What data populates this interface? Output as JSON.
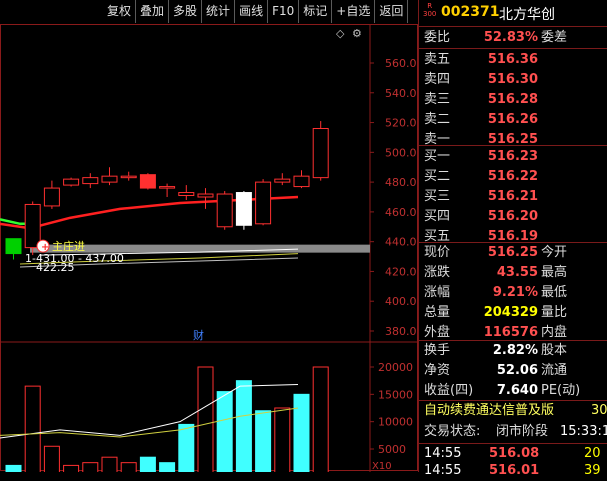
{
  "toolbar": [
    "复权",
    "叠加",
    "多股",
    "统计",
    "画线",
    "F10",
    "标记",
    "+自选",
    "返回"
  ],
  "stock": {
    "badge_top": "R",
    "badge_bottom": "300",
    "code": "002371",
    "name": "北方华创"
  },
  "webi": {
    "label": "委比",
    "value": "52.83%",
    "label2": "委差"
  },
  "asks": [
    {
      "label": "卖五",
      "price": "516.36"
    },
    {
      "label": "卖四",
      "price": "516.30"
    },
    {
      "label": "卖三",
      "price": "516.28"
    },
    {
      "label": "卖二",
      "price": "516.26"
    },
    {
      "label": "卖一",
      "price": "516.25"
    }
  ],
  "bids": [
    {
      "label": "买一",
      "price": "516.23"
    },
    {
      "label": "买二",
      "price": "516.22"
    },
    {
      "label": "买三",
      "price": "516.21"
    },
    {
      "label": "买四",
      "price": "516.20"
    },
    {
      "label": "买五",
      "price": "516.19"
    }
  ],
  "stats": [
    {
      "label": "现价",
      "value": "516.25",
      "color": "red",
      "label2": "今开"
    },
    {
      "label": "涨跌",
      "value": "43.55",
      "color": "red",
      "label2": "最高"
    },
    {
      "label": "涨幅",
      "value": "9.21%",
      "color": "red",
      "label2": "最低"
    },
    {
      "label": "总量",
      "value": "204329",
      "color": "yel",
      "label2": "量比"
    },
    {
      "label": "外盘",
      "value": "116576",
      "color": "red",
      "label2": "内盘"
    }
  ],
  "stats2": [
    {
      "label": "换手",
      "value": "2.82%",
      "color": "wht",
      "label2": "股本"
    },
    {
      "label": "净资",
      "value": "52.06",
      "color": "wht",
      "label2": "流通"
    },
    {
      "label": "收益(四)",
      "value": "7.640",
      "color": "wht",
      "label2": "PE(动)"
    }
  ],
  "info": {
    "industry": "自动续费通达信普及版",
    "industry_num": "30",
    "status_label": "交易状态:",
    "status": "闭市阶段",
    "time": "15:33:1"
  },
  "ticks": [
    {
      "time": "14:55",
      "price": "516.08",
      "vol": "20"
    },
    {
      "time": "14:55",
      "price": "516.01",
      "vol": "39"
    }
  ],
  "chart_annotations": {
    "diamond": "◇",
    "gear": "⚙",
    "main_force": "主庄进",
    "ma_text": "437.00",
    "ma_text_prefix": "1-431.00 -",
    "low_label": "422.25",
    "cai": "财",
    "x10": "X10"
  },
  "chart_data": {
    "type": "candlestick",
    "price_axis": {
      "labels": [
        "560.0",
        "540.0",
        "520.0",
        "500.0",
        "480.0",
        "460.0",
        "440.0",
        "420.0",
        "400.0",
        "380.0"
      ],
      "values": [
        560,
        540,
        520,
        500,
        480,
        460,
        440,
        420,
        400,
        380
      ]
    },
    "volume_axis": {
      "labels": [
        "20000",
        "15000",
        "10000",
        "5000"
      ],
      "values": [
        20000,
        15000,
        10000,
        5000
      ]
    },
    "candles": [
      {
        "o": 432,
        "c": 442,
        "h": 442,
        "l": 428,
        "color": "green"
      },
      {
        "o": 436,
        "c": 465,
        "h": 467,
        "l": 431,
        "color": "red_hollow"
      },
      {
        "o": 464,
        "c": 476,
        "h": 481,
        "l": 462,
        "color": "red_hollow"
      },
      {
        "o": 478,
        "c": 482,
        "h": 483,
        "l": 477,
        "color": "red_hollow"
      },
      {
        "o": 479,
        "c": 483,
        "h": 486,
        "l": 476,
        "color": "red_hollow"
      },
      {
        "o": 480,
        "c": 484,
        "h": 490,
        "l": 478,
        "color": "red_hollow"
      },
      {
        "o": 484,
        "c": 484,
        "h": 487,
        "l": 481,
        "color": "red_hollow"
      },
      {
        "o": 485,
        "c": 476,
        "h": 486,
        "l": 475,
        "color": "red"
      },
      {
        "o": 476,
        "c": 477,
        "h": 479,
        "l": 470,
        "color": "red_hollow"
      },
      {
        "o": 471,
        "c": 473,
        "h": 478,
        "l": 468,
        "color": "red_hollow"
      },
      {
        "o": 470,
        "c": 472,
        "h": 476,
        "l": 462,
        "color": "red_hollow"
      },
      {
        "o": 450,
        "c": 472,
        "h": 474,
        "l": 448,
        "color": "red_hollow"
      },
      {
        "o": 473,
        "c": 451,
        "h": 474,
        "l": 448,
        "color": "white"
      },
      {
        "o": 452,
        "c": 480,
        "h": 482,
        "l": 451,
        "color": "red_hollow"
      },
      {
        "o": 480,
        "c": 482,
        "h": 486,
        "l": 478,
        "color": "red_hollow"
      },
      {
        "o": 477,
        "c": 484,
        "h": 488,
        "l": 476,
        "color": "red_hollow"
      },
      {
        "o": 483,
        "c": 516,
        "h": 521,
        "l": 481,
        "color": "red_hollow"
      }
    ],
    "volumes": [
      {
        "v": 2000,
        "color": "cyan"
      },
      {
        "v": 16500,
        "color": "red_hollow"
      },
      {
        "v": 5500,
        "color": "red_hollow"
      },
      {
        "v": 2000,
        "color": "red_hollow"
      },
      {
        "v": 2500,
        "color": "red_hollow"
      },
      {
        "v": 3500,
        "color": "red_hollow"
      },
      {
        "v": 2500,
        "color": "red_hollow"
      },
      {
        "v": 3500,
        "color": "cyan"
      },
      {
        "v": 2500,
        "color": "cyan"
      },
      {
        "v": 9500,
        "color": "cyan"
      },
      {
        "v": 20000,
        "color": "red_hollow"
      },
      {
        "v": 15500,
        "color": "cyan"
      },
      {
        "v": 17500,
        "color": "cyan"
      },
      {
        "v": 12000,
        "color": "cyan"
      },
      {
        "v": 12500,
        "color": "red_hollow"
      },
      {
        "v": 15000,
        "color": "cyan"
      },
      {
        "v": 20000,
        "color": "red_hollow"
      }
    ]
  }
}
